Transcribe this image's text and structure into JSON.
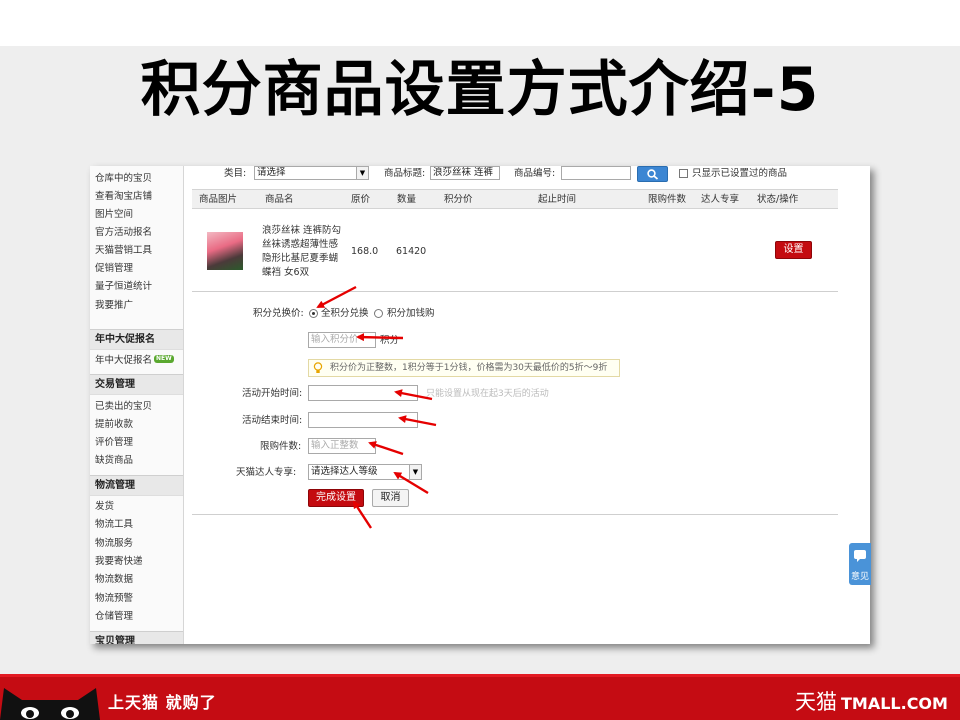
{
  "slide": {
    "title": "积分商品设置方式介绍-5"
  },
  "sidebar": {
    "top_items": [
      "仓库中的宝贝",
      "查看淘宝店铺",
      "图片空间",
      "官方活动报名",
      "天猫营销工具",
      "促销管理",
      "量子恒道统计",
      "我要推广"
    ],
    "sections": [
      {
        "title": "年中大促报名",
        "items": [
          "年中大促报名"
        ],
        "badge": "NEW"
      },
      {
        "title": "交易管理",
        "items": [
          "已卖出的宝贝",
          "提前收款",
          "评价管理",
          "缺货商品"
        ]
      },
      {
        "title": "物流管理",
        "items": [
          "发货",
          "物流工具",
          "物流服务",
          "我要寄快递",
          "物流数据",
          "物流预警",
          "仓储管理"
        ]
      },
      {
        "title": "宝贝管理",
        "items": []
      }
    ]
  },
  "filters": {
    "category_label": "类目:",
    "category_value": "请选择",
    "title_label": "商品标题:",
    "title_value": "浪莎丝袜 连裤",
    "code_label": "商品编号:",
    "code_value": "",
    "only_set_label": "只显示已设置过的商品"
  },
  "table": {
    "headers": [
      "商品图片",
      "商品名",
      "原价",
      "数量",
      "积分价",
      "起止时间",
      "限购件数",
      "达人专享",
      "状态/操作"
    ],
    "row": {
      "name_lines": [
        "浪莎丝袜 连裤防勾",
        "丝袜诱惑超薄性感",
        "隐形比基尼夏季蝴",
        "蝶裆 女6双"
      ],
      "price": "168.0",
      "quantity": "61420",
      "action": "设置"
    }
  },
  "form": {
    "exchange_label": "积分兑换价:",
    "radio_full": "全积分兑换",
    "radio_mixed": "积分加钱购",
    "points_placeholder": "输入积分价",
    "points_unit": "积分",
    "tip": "积分价为正整数，1积分等于1分钱，价格需为30天最低价的5折～9折",
    "start_label": "活动开始时间:",
    "start_hint": "只能设置从现在起3天后的活动",
    "end_label": "活动结束时间:",
    "limit_label": "限购件数:",
    "limit_placeholder": "输入正整数",
    "vip_label": "天猫达人专享:",
    "vip_value": "请选择达人等级",
    "submit": "完成设置",
    "cancel": "取消"
  },
  "feedback": {
    "label": "意见"
  },
  "footer": {
    "slogan": "上天猫 就购了",
    "brand_cn": "天猫",
    "brand_en": "TMALL.COM"
  },
  "colors": {
    "brand_red": "#c50c13",
    "button_red": "#c40b10",
    "search_blue": "#3c86d3",
    "arrow_red": "#e50000"
  }
}
